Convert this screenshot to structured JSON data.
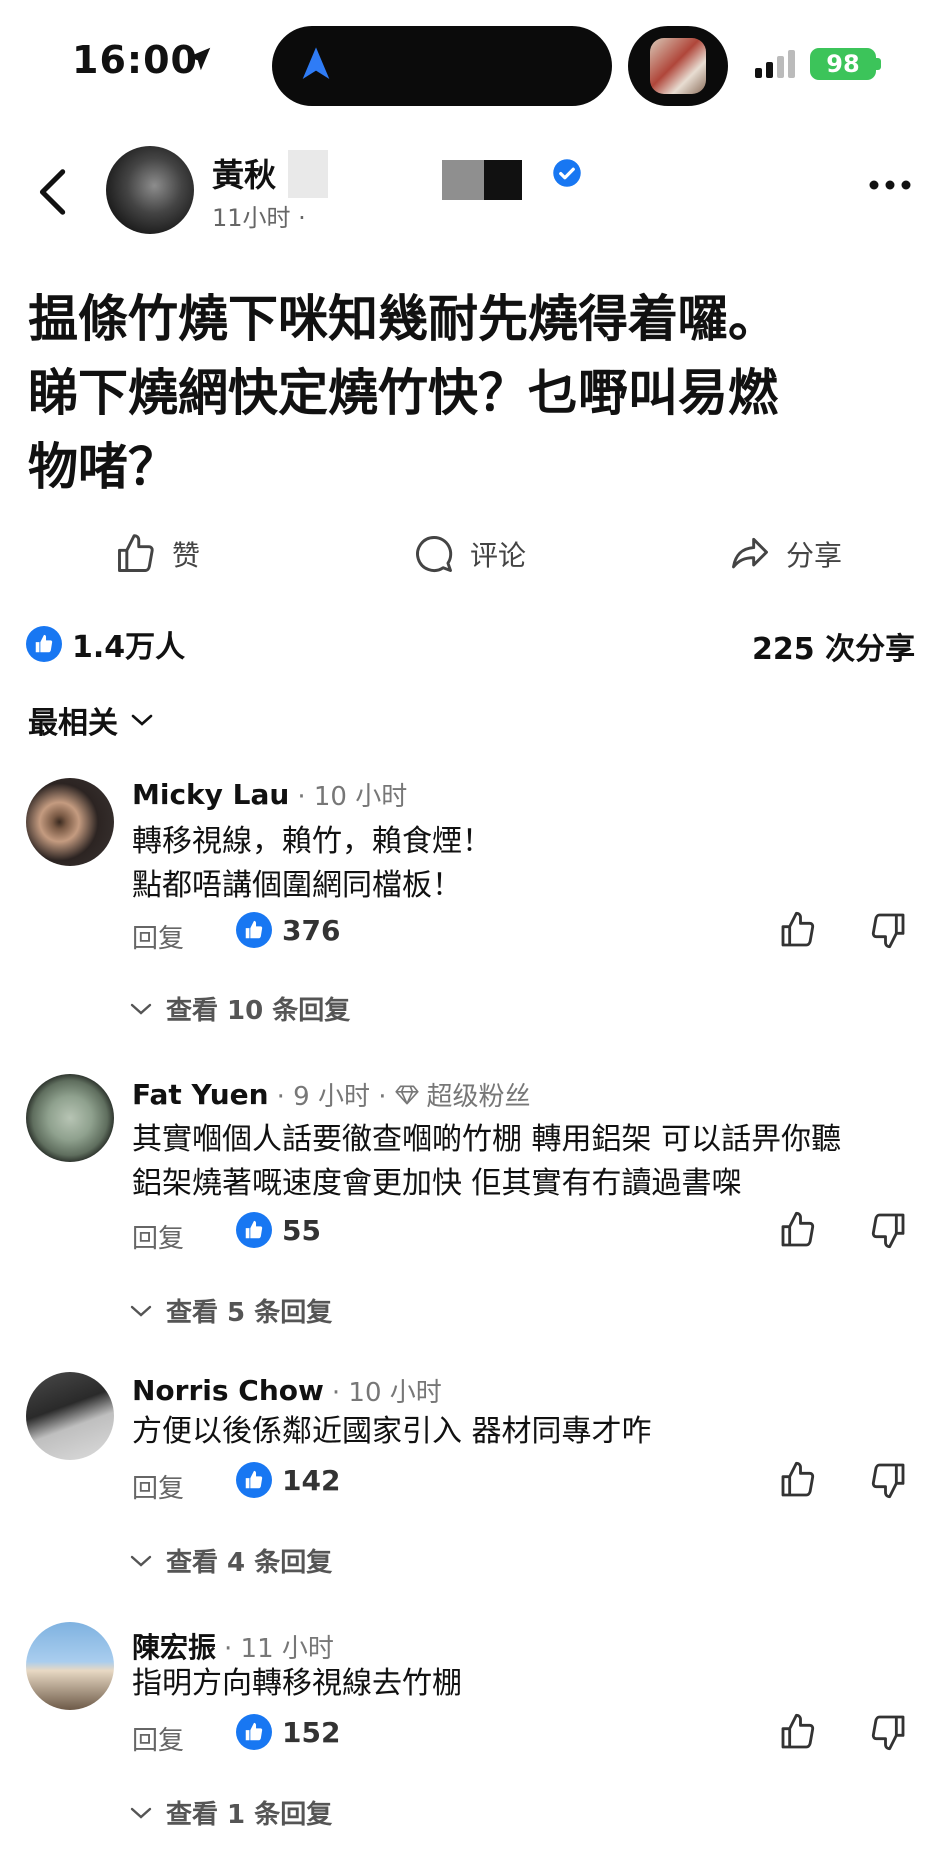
{
  "status_bar": {
    "time": "16:00",
    "battery": "98"
  },
  "header": {
    "author_name": "黃秋",
    "post_time": "11小时 ·"
  },
  "post": {
    "lines": [
      "揾條竹燒下咪知幾耐先燒得着囉。",
      "睇下燒網快定燒竹快？乜嘢叫易燃",
      "物啫？"
    ]
  },
  "actions": {
    "like": "赞",
    "comment": "评论",
    "share": "分享"
  },
  "stats": {
    "likes": "1.4万人",
    "shares": "225 次分享"
  },
  "sort_label": "最相关",
  "comments": [
    {
      "name": "Micky Lau",
      "time": "· 10 小时",
      "badge": "",
      "lines": [
        "轉移視線，賴竹，賴食煙！",
        "點都唔講個圍網同檔板！"
      ],
      "reply": "回复",
      "likes": "376",
      "view_replies": "查看 10 条回复"
    },
    {
      "name": "Fat Yuen",
      "time": "· 9 小时 ·",
      "badge": "超级粉丝",
      "lines": [
        "其實嗰個人話要徹查嗰啲竹棚 轉用鋁架 可以話畀你聽",
        "鋁架燒著嘅速度會更加快 佢其實有冇讀過書㗎"
      ],
      "reply": "回复",
      "likes": "55",
      "view_replies": "查看 5 条回复"
    },
    {
      "name": "Norris Chow",
      "time": "· 10 小时",
      "badge": "",
      "lines": [
        "方便以後係鄰近國家引入 器材同專才咋"
      ],
      "reply": "回复",
      "likes": "142",
      "view_replies": "查看 4 条回复"
    },
    {
      "name": "陳宏振",
      "time": "· 11 小时",
      "badge": "",
      "lines": [
        "指明方向轉移視線去竹棚"
      ],
      "reply": "回复",
      "likes": "152",
      "view_replies": "查看 1 条回复"
    }
  ],
  "colors": {
    "accent": "#1877f2",
    "battery": "#3cc45a"
  }
}
